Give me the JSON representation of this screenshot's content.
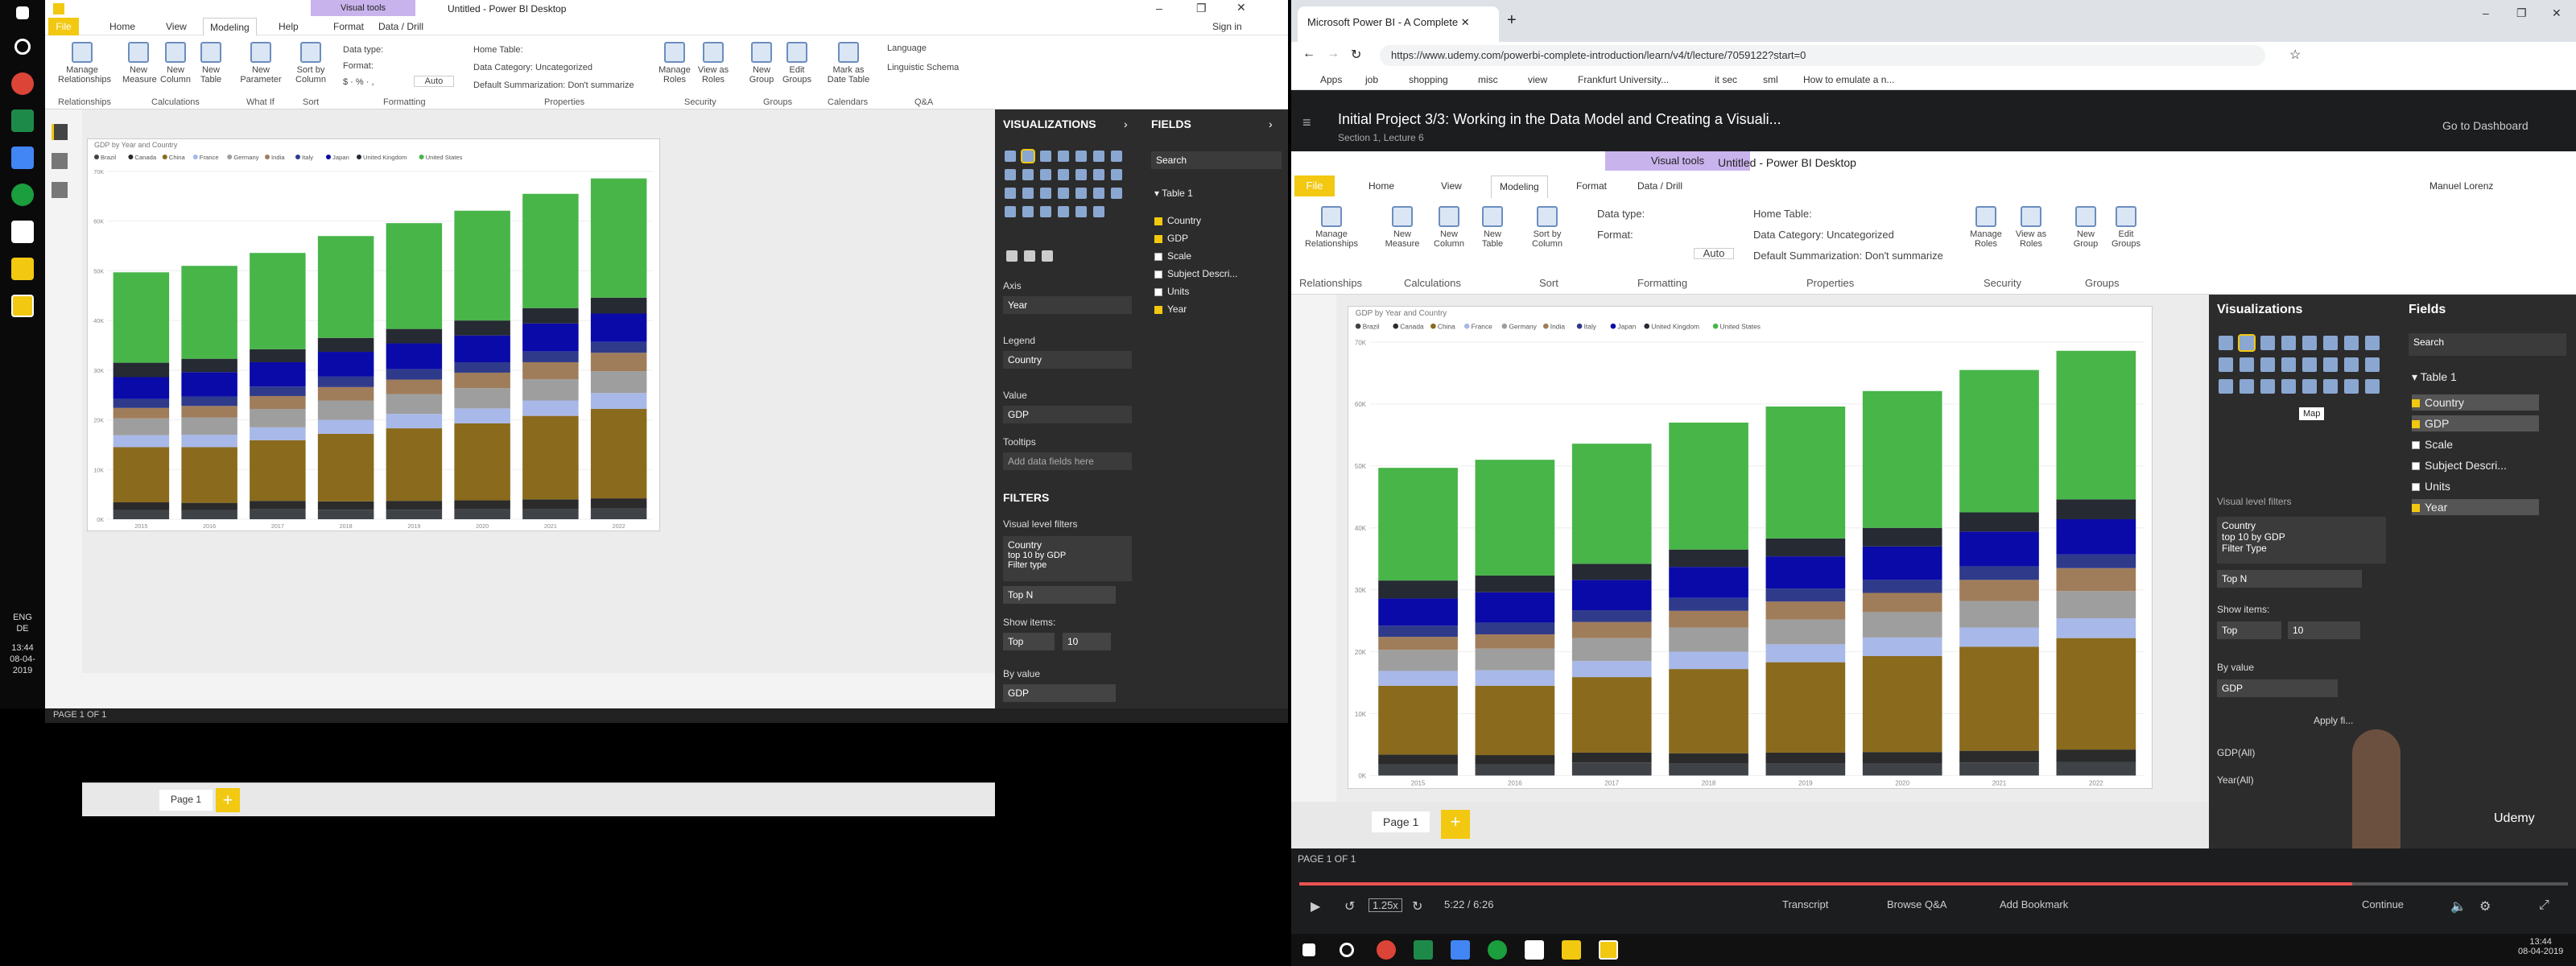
{
  "left_window": {
    "title": "Untitled - Power BI Desktop",
    "contextual_tab": "Visual tools",
    "sign_in": "Sign in",
    "menu": [
      "File",
      "Home",
      "View",
      "Modeling",
      "Help",
      "Format",
      "Data / Drill"
    ],
    "ribbon": {
      "buttons": [
        "Manage Relationships",
        "New Measure",
        "New Column",
        "New Table",
        "New Parameter",
        "Sort by Column",
        "Manage Roles",
        "View as Roles",
        "New Group",
        "Edit Groups",
        "Mark as Date Table"
      ],
      "datatype": "Data type:",
      "format": "Format:",
      "auto": "Auto",
      "home_table": "Home Table:",
      "data_category": "Data Category: Uncategorized",
      "default_summ": "Default Summarization: Don't summarize",
      "language": "Language",
      "linguistic": "Linguistic Schema",
      "groups": [
        "Relationships",
        "Calculations",
        "What If",
        "Sort",
        "Formatting",
        "Properties",
        "Security",
        "Groups",
        "Calendars",
        "Q&A"
      ]
    },
    "page_tab": "Page 1",
    "status": "PAGE 1 OF 1",
    "visualizations": {
      "title": "VISUALIZATIONS",
      "axis": "Axis",
      "axis_val": "Year",
      "legend": "Legend",
      "legend_val": "Country",
      "value": "Value",
      "value_val": "GDP",
      "tooltips": "Tooltips",
      "tooltips_val": "Add data fields here",
      "filters": "FILTERS",
      "vlf": "Visual level filters",
      "f_country": "Country",
      "f_top": "top 10 by GDP",
      "f_type": "Filter type",
      "f_topn": "Top N",
      "show_items": "Show items:",
      "top": "Top",
      "ten": "10",
      "by_value": "By value",
      "by_gdp": "GDP"
    },
    "fields": {
      "title": "FIELDS",
      "search": "Search",
      "table": "Table 1",
      "items": [
        {
          "name": "Country",
          "on": true
        },
        {
          "name": "GDP",
          "on": true
        },
        {
          "name": "Scale",
          "on": false
        },
        {
          "name": "Subject Descri...",
          "on": false
        },
        {
          "name": "Units",
          "on": false
        },
        {
          "name": "Year",
          "on": true
        }
      ]
    }
  },
  "taskbar_clock": {
    "time": "13:44",
    "date": "08-04-2019",
    "lang1": "ENG",
    "lang2": "DE"
  },
  "browser": {
    "tab": "Microsoft Power BI - A Complete",
    "url": "https://www.udemy.com/powerbi-complete-introduction/learn/v4/t/lecture/7059122?start=0",
    "bookmarks": [
      "Apps",
      "job",
      "shopping",
      "misc",
      "view",
      "Frankfurt University...",
      "it sec",
      "sml",
      "How to emulate a n..."
    ],
    "course_title": "Initial Project 3/3: Working in the Data Model and Creating a Visuali...",
    "section": "Section 1, Lecture 6",
    "dashboard": "Go to Dashboard"
  },
  "video": {
    "title": "Untitled - Power BI Desktop",
    "contextual_tab": "Visual tools",
    "user": "Manuel Lorenz",
    "menu": [
      "File",
      "Home",
      "View",
      "Modeling",
      "Format",
      "Data / Drill"
    ],
    "buttons": [
      "Manage Relationships",
      "New Measure",
      "New Column",
      "New Table",
      "Sort by Column",
      "Manage Roles",
      "View as Roles",
      "New Group",
      "Edit Groups"
    ],
    "groups": [
      "Relationships",
      "Calculations",
      "Sort",
      "Formatting",
      "Properties",
      "Security",
      "Groups"
    ],
    "datatype": "Data type:",
    "format": "Format:",
    "auto": "Auto",
    "home_table": "Home Table:",
    "data_category": "Data Category: Uncategorized",
    "default_summ": "Default Summarization: Don't summarize",
    "viz_title": "Visualizations",
    "fields_title": "Fields",
    "search": "Search",
    "table": "Table 1",
    "fields": [
      {
        "name": "Country",
        "on": true
      },
      {
        "name": "GDP",
        "on": true
      },
      {
        "name": "Scale",
        "on": false
      },
      {
        "name": "Subject Descri...",
        "on": false
      },
      {
        "name": "Units",
        "on": false
      },
      {
        "name": "Year",
        "on": true
      }
    ],
    "tooltip": "Map",
    "vlf": "Visual level filters",
    "f_country": "Country",
    "f_top": "top 10 by GDP",
    "f_type": "Filter Type",
    "f_topn": "Top N",
    "show_items": "Show items:",
    "top": "Top",
    "ten": "10",
    "by_value": "By value",
    "by_gdp": "GDP",
    "apply": "Apply fi...",
    "gdp_all": "GDP(All)",
    "year_all": "Year(All)",
    "page_tab": "Page 1",
    "status": "PAGE 1 OF 1"
  },
  "player": {
    "time": "5:22 / 6:26",
    "speed": "1.25x",
    "transcript": "Transcript",
    "qa": "Browse Q&A",
    "bookmark": "Add Bookmark",
    "continue": "Continue",
    "brand": "Udemy",
    "progress": 0.83
  },
  "win_clock": {
    "time": "13:44",
    "date": "08-04-2019"
  },
  "chart_data": {
    "type": "bar",
    "title": "GDP by Year and Country",
    "categories": [
      "2015",
      "2016",
      "2017",
      "2018",
      "2019",
      "2020",
      "2021",
      "2022"
    ],
    "legend": [
      "Brazil",
      "Canada",
      "China",
      "France",
      "Germany",
      "India",
      "Italy",
      "Japan",
      "United Kingdom",
      "United States"
    ],
    "colors": [
      "#3f4347",
      "#2b2b2b",
      "#8a6a1c",
      "#a8b8e8",
      "#9e9e9e",
      "#a07d5a",
      "#2f3a8a",
      "#0a0aa8",
      "#252a33",
      "#48b549"
    ],
    "series": [
      {
        "name": "Brazil",
        "values": [
          1.8,
          1.8,
          2.1,
          1.9,
          1.9,
          2.0,
          2.1,
          2.2
        ]
      },
      {
        "name": "Canada",
        "values": [
          1.6,
          1.5,
          1.6,
          1.7,
          1.8,
          1.8,
          1.9,
          2.0
        ]
      },
      {
        "name": "China",
        "values": [
          11.1,
          11.2,
          12.2,
          13.6,
          14.6,
          15.5,
          16.8,
          18.0
        ]
      },
      {
        "name": "France",
        "values": [
          2.4,
          2.5,
          2.6,
          2.8,
          2.9,
          3.0,
          3.1,
          3.2
        ]
      },
      {
        "name": "Germany",
        "values": [
          3.4,
          3.5,
          3.7,
          3.9,
          4.0,
          4.1,
          4.3,
          4.4
        ]
      },
      {
        "name": "India",
        "values": [
          2.1,
          2.3,
          2.6,
          2.7,
          2.9,
          3.1,
          3.4,
          3.7
        ]
      },
      {
        "name": "Italy",
        "values": [
          1.8,
          1.9,
          1.9,
          2.1,
          2.1,
          2.1,
          2.2,
          2.2
        ]
      },
      {
        "name": "Japan",
        "values": [
          4.4,
          4.9,
          4.9,
          5.0,
          5.2,
          5.4,
          5.6,
          5.7
        ]
      },
      {
        "name": "United Kingdom",
        "values": [
          2.9,
          2.7,
          2.6,
          2.8,
          2.9,
          3.0,
          3.1,
          3.2
        ]
      },
      {
        "name": "United States",
        "values": [
          18.2,
          18.7,
          19.4,
          20.5,
          21.3,
          22.1,
          23.0,
          24.0
        ]
      }
    ],
    "y_ticks": [
      "0K",
      "10K",
      "20K",
      "30K",
      "40K",
      "50K",
      "60K",
      "70K"
    ],
    "ylim": [
      0,
      70
    ]
  }
}
